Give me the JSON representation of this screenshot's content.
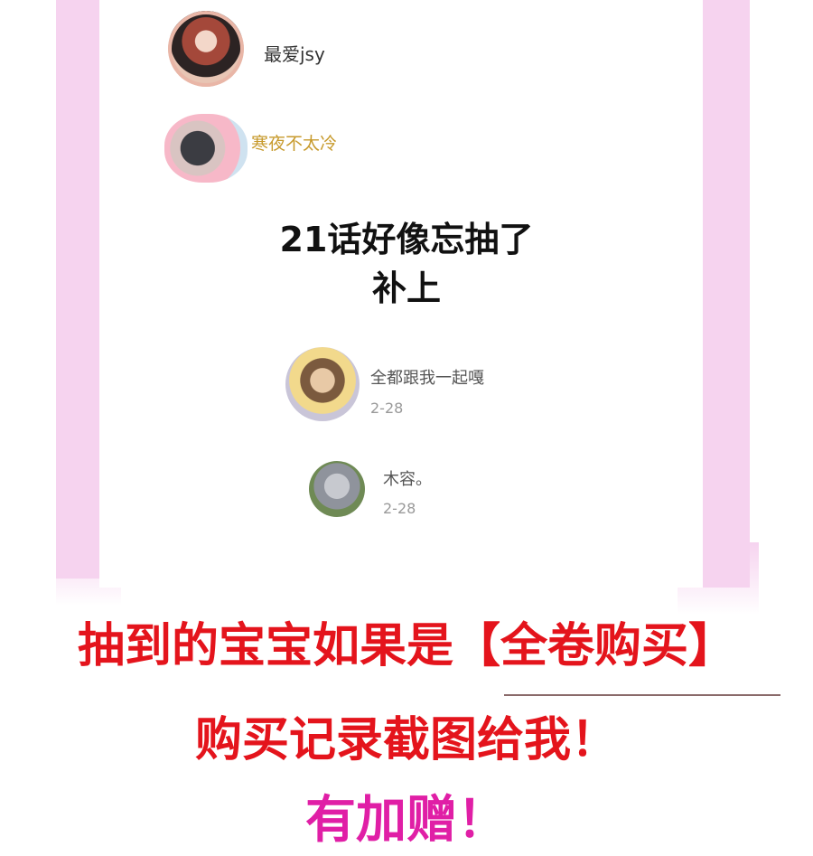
{
  "comments": [
    {
      "username": "最爱jsy"
    },
    {
      "username": "寒夜不太冷"
    }
  ],
  "headline": {
    "line1": "21话好像忘抽了",
    "line2": "补上"
  },
  "replies": [
    {
      "username": "全都跟我一起嘎",
      "date": "2-28"
    },
    {
      "username": "木容。",
      "date": "2-28"
    }
  ],
  "promo": {
    "line1": "抽到的宝宝如果是【全卷购买】",
    "line2": "购买记录截图给我！",
    "line3": "有加赠！"
  },
  "colors": {
    "frame": "#f6d3ef",
    "promo_red": "#e4141c",
    "promo_pink": "#e01fa6"
  }
}
